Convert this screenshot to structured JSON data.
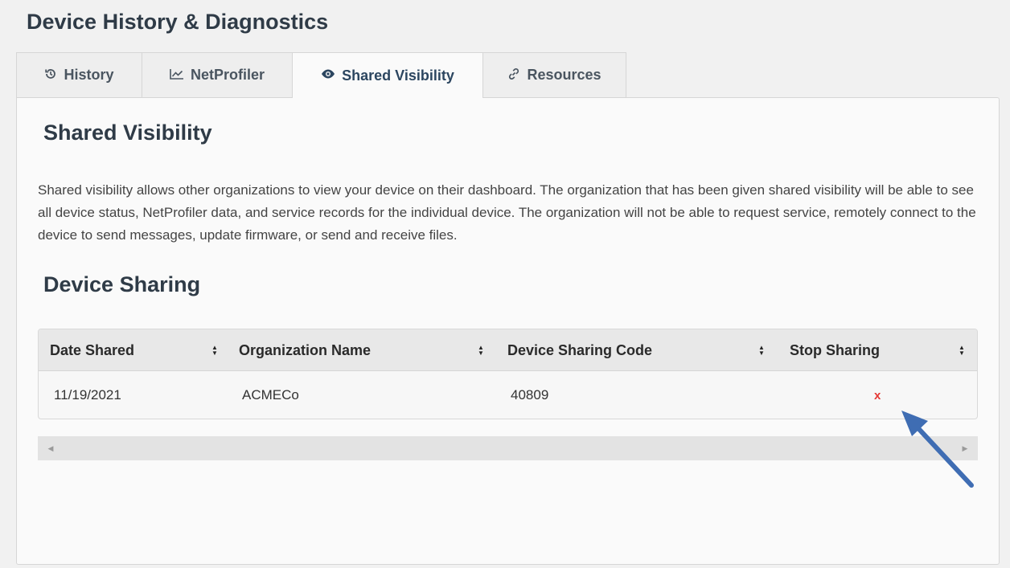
{
  "page": {
    "title": "Device History & Diagnostics"
  },
  "tabs": [
    {
      "label": "History",
      "icon": "history-icon",
      "active": false
    },
    {
      "label": "NetProfiler",
      "icon": "line-chart-icon",
      "active": false
    },
    {
      "label": "Shared Visibility",
      "icon": "eye-icon",
      "active": true
    },
    {
      "label": "Resources",
      "icon": "link-icon",
      "active": false
    }
  ],
  "shared_visibility": {
    "title": "Shared Visibility",
    "description": "Shared visibility allows other organizations to view your device on their dashboard. The organization that has been given shared visibility will be able to see all device status, NetProfiler data, and service records for the individual device. The organization will not be able to request service, remotely connect to the device to send messages, update firmware, or send and receive files."
  },
  "device_sharing": {
    "title": "Device Sharing",
    "columns": [
      "Date Shared",
      "Organization Name",
      "Device Sharing Code",
      "Stop Sharing"
    ],
    "rows": [
      {
        "date_shared": "11/19/2021",
        "organization_name": "ACMECo",
        "device_sharing_code": "40809",
        "stop_sharing": "x"
      }
    ]
  },
  "colors": {
    "accent_arrow": "#3f6db3",
    "stop_sharing": "#e53935",
    "active_tab_text": "#2c4660"
  }
}
